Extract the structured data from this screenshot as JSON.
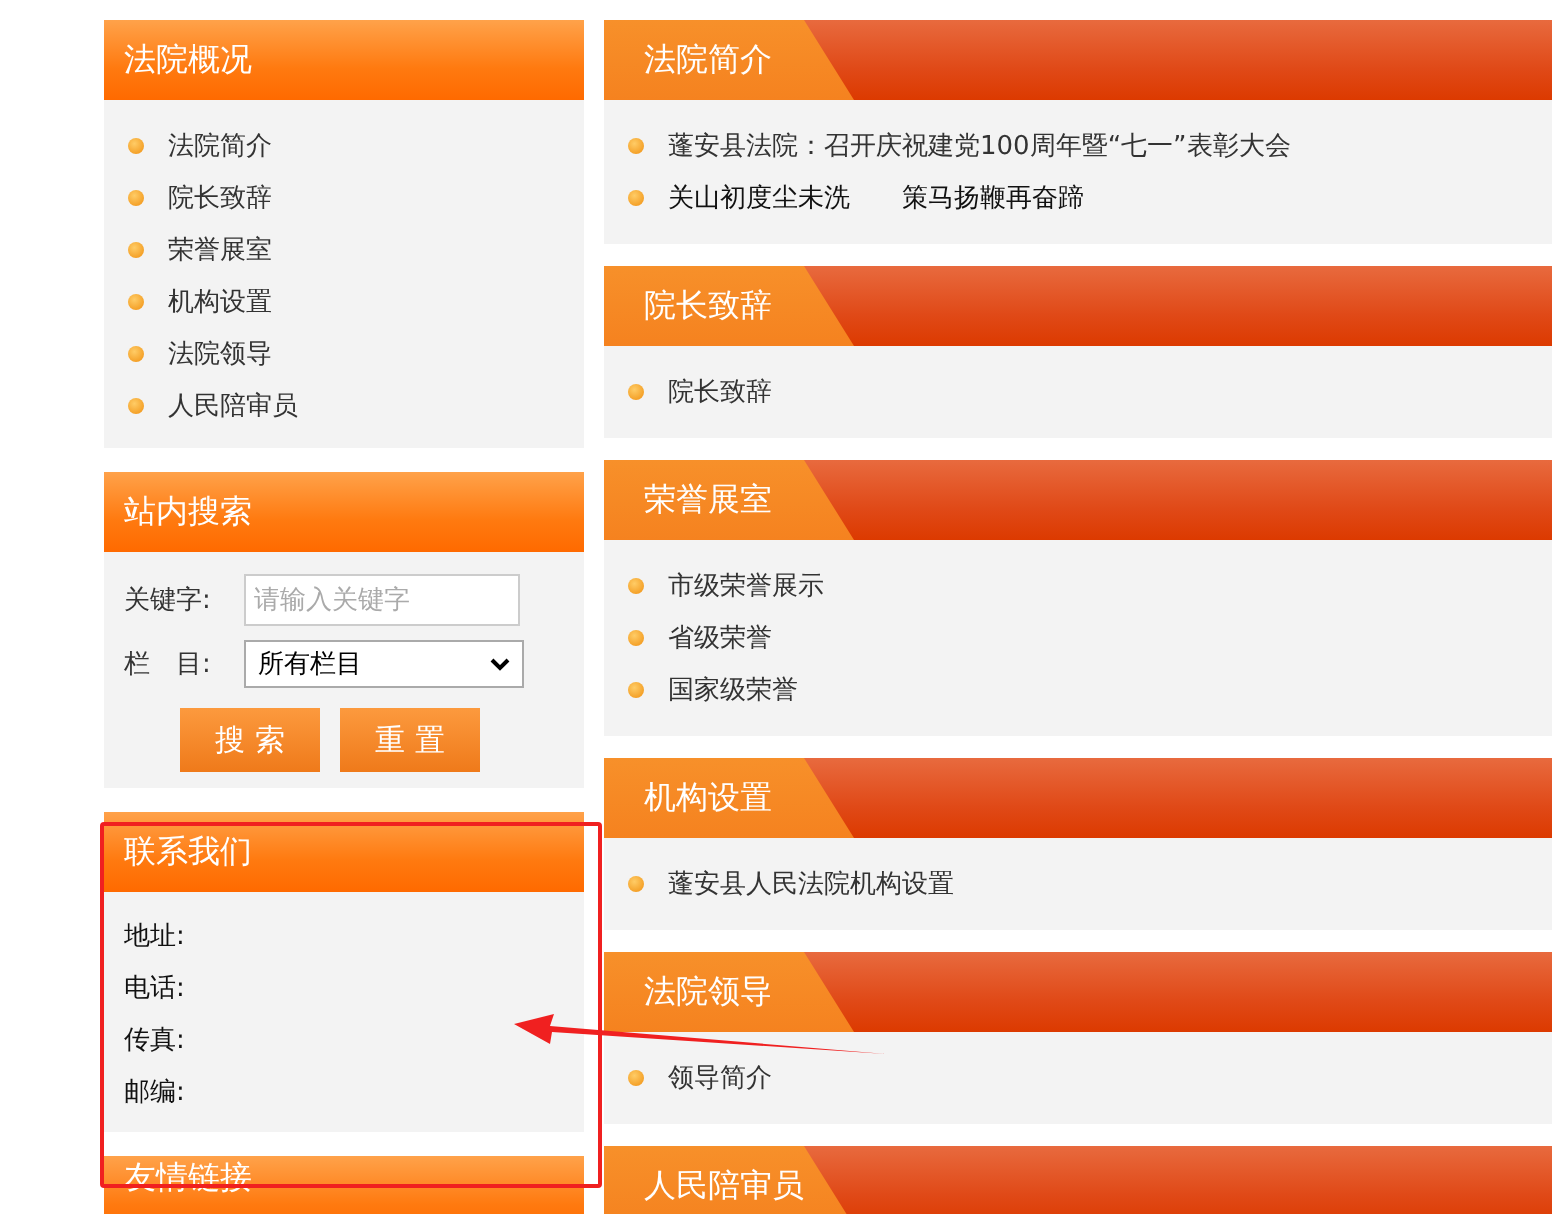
{
  "left_panels": [
    {
      "kind": "links",
      "title": "法院概况",
      "items": [
        "法院简介",
        "院长致辞",
        "荣誉展室",
        "机构设置",
        "法院领导",
        "人民陪审员"
      ]
    },
    {
      "kind": "search",
      "title": "站内搜索",
      "keyword_label": "关键字:",
      "keyword_placeholder": "请输入关键字",
      "column_label": "栏　目:",
      "column_value": "所有栏目",
      "buttons": [
        "搜 索",
        "重 置"
      ]
    },
    {
      "kind": "contact",
      "title": "联系我们",
      "lines": [
        "地址:",
        "电话:",
        "传真:",
        "邮编:"
      ]
    },
    {
      "kind": "links",
      "title": "友情链接"
    }
  ],
  "right_sections": [
    {
      "title": "法院简介",
      "items": [
        "蓬安县法院：召开庆祝建党100周年暨“七一”表彰大会",
        "关山初度尘未洗　　策马扬鞭再奋蹄"
      ]
    },
    {
      "title": "院长致辞",
      "items": [
        "院长致辞"
      ]
    },
    {
      "title": "荣誉展室",
      "items": [
        "市级荣誉展示",
        "省级荣誉",
        "国家级荣誉"
      ]
    },
    {
      "title": "机构设置",
      "items": [
        "蓬安县人民法院机构设置"
      ]
    },
    {
      "title": "法院领导",
      "items": [
        "领导简介"
      ]
    },
    {
      "title": "人民陪审员"
    }
  ]
}
